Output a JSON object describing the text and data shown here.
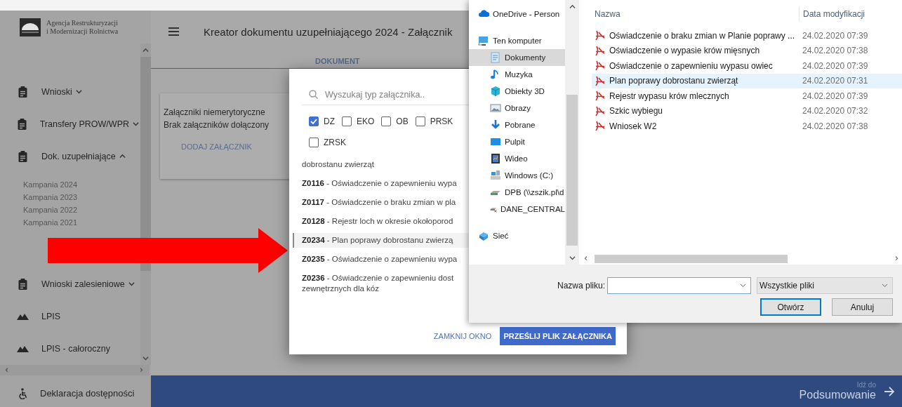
{
  "sidebar": {
    "logo_lines": [
      "Agencja Restrukturyzacji",
      "i Modernizacji Rolnictwa"
    ],
    "items": [
      {
        "label": "Wnioski",
        "kind": "document",
        "expanded": false
      },
      {
        "label": "Transfery PROW/WPR",
        "kind": "document",
        "expanded": false
      },
      {
        "label": "Dok. uzupełniające",
        "kind": "document",
        "expanded": true,
        "children": [
          {
            "label": "Kampania 2024"
          },
          {
            "label": "Kampania 2023"
          },
          {
            "label": "Kampania 2022"
          },
          {
            "label": "Kampania 2021"
          }
        ]
      },
      {
        "label": "Wnioski zalesieniowe",
        "kind": "document",
        "expanded": false
      },
      {
        "label": "LPIS",
        "kind": "map"
      },
      {
        "label": "LPIS - całoroczny",
        "kind": "map"
      }
    ],
    "footer_link": {
      "label": "Deklaracja dostępności"
    }
  },
  "main": {
    "title": "Kreator dokumentu uzupełniającego 2024 - Załącznik",
    "tabs": [
      {
        "label": "DOKUMENT",
        "selected": true
      }
    ],
    "card": {
      "heading": "Załączniki niemerytoryczne",
      "status": "Brak załączników dołączony",
      "action": "DODAJ ZAŁĄCZNIK"
    },
    "footer": {
      "hint": "Idź do",
      "target": "Podsumowanie"
    }
  },
  "attachment_dialog": {
    "search_placeholder": "Wyszukaj typ załącznika..",
    "filters": [
      {
        "label": "DZ",
        "checked": true
      },
      {
        "label": "EKO",
        "checked": false
      },
      {
        "label": "OB",
        "checked": false
      },
      {
        "label": "PRSK",
        "checked": false
      },
      {
        "label": "ZRSK",
        "checked": false
      }
    ],
    "items": [
      {
        "lines": [
          "dobrostanu zwierząt"
        ],
        "selected": false
      },
      {
        "lines": [
          "**Z0116** - Oświadczenie o zapewnieniu wypa"
        ],
        "selected": false
      },
      {
        "lines": [
          "**Z0117** - Oświadczenie o braku zmian w pla"
        ],
        "selected": false
      },
      {
        "lines": [
          "**Z0128** - Rejestr loch w okresie okołoporod"
        ],
        "selected": false
      },
      {
        "lines": [
          "**Z0234** - Plan poprawy dobrostanu zwierzą"
        ],
        "selected": true
      },
      {
        "lines": [
          "**Z0235** - Oświadczenie o zapewnieniu wypa"
        ],
        "selected": false
      },
      {
        "lines": [
          "**Z0236** - Oświadczenie o zapewnieniu dost",
          "zewnętrznych dla kóz"
        ],
        "selected": false
      }
    ],
    "buttons": [
      {
        "label": "ZAMKNIJ OKNO",
        "kind": "text"
      },
      {
        "label": "PRZEŚLIJ PLIK ZAŁĄCZNIKA",
        "kind": "filled"
      }
    ]
  },
  "file_dialog": {
    "nav": [
      {
        "label": "OneDrive - Person",
        "kind": "cloud",
        "selected": false
      },
      {
        "label": "Ten komputer",
        "kind": "computer",
        "selected": false,
        "children": [
          {
            "label": "Dokumenty",
            "kind": "documents",
            "selected": true
          },
          {
            "label": "Muzyka",
            "kind": "music",
            "selected": false
          },
          {
            "label": "Obiekty 3D",
            "kind": "objects3d",
            "selected": false
          },
          {
            "label": "Obrazy",
            "kind": "pictures",
            "selected": false
          },
          {
            "label": "Pobrane",
            "kind": "downloads",
            "selected": false
          },
          {
            "label": "Pulpit",
            "kind": "desktop",
            "selected": false
          },
          {
            "label": "Wideo",
            "kind": "videos",
            "selected": false
          },
          {
            "label": "Windows (C:)",
            "kind": "drive",
            "selected": false
          },
          {
            "label": "DPB (\\\\zszik.pl\\d",
            "kind": "network-drive",
            "selected": false
          },
          {
            "label": "DANE_CENTRAL",
            "kind": "disconnected-drive",
            "selected": false
          }
        ]
      },
      {
        "label": "Sieć",
        "kind": "network",
        "selected": false
      }
    ],
    "columns": [
      "Nazwa",
      "Data modyfikacji"
    ],
    "files": [
      {
        "name": "Oświadczenie o braku zmian w Planie poprawy ...",
        "modified": "24.02.2020 07:39",
        "selected": false
      },
      {
        "name": "Oświadczenie o wypasie krów mięsnych",
        "modified": "24.02.2020 07:38",
        "selected": false
      },
      {
        "name": "Oświadczenie o zapewnieniu wypasu owiec",
        "modified": "24.02.2020 07:39",
        "selected": false
      },
      {
        "name": "Plan poprawy dobrostanu zwierząt",
        "modified": "24.02.2020 07:31",
        "selected": true
      },
      {
        "name": "Rejestr wypasu krów mlecznych",
        "modified": "24.02.2020 07:39",
        "selected": false
      },
      {
        "name": "Szkic wybiegu",
        "modified": "24.02.2020 07:32",
        "selected": false
      },
      {
        "name": "Wniosek W2",
        "modified": "24.02.2020 07:38",
        "selected": false
      }
    ],
    "filename_label": "Nazwa pliku:",
    "filetype": "Wszystkie pliki",
    "buttons": [
      {
        "label": "Otwórz",
        "default": true
      },
      {
        "label": "Anuluj",
        "default": false
      }
    ]
  }
}
